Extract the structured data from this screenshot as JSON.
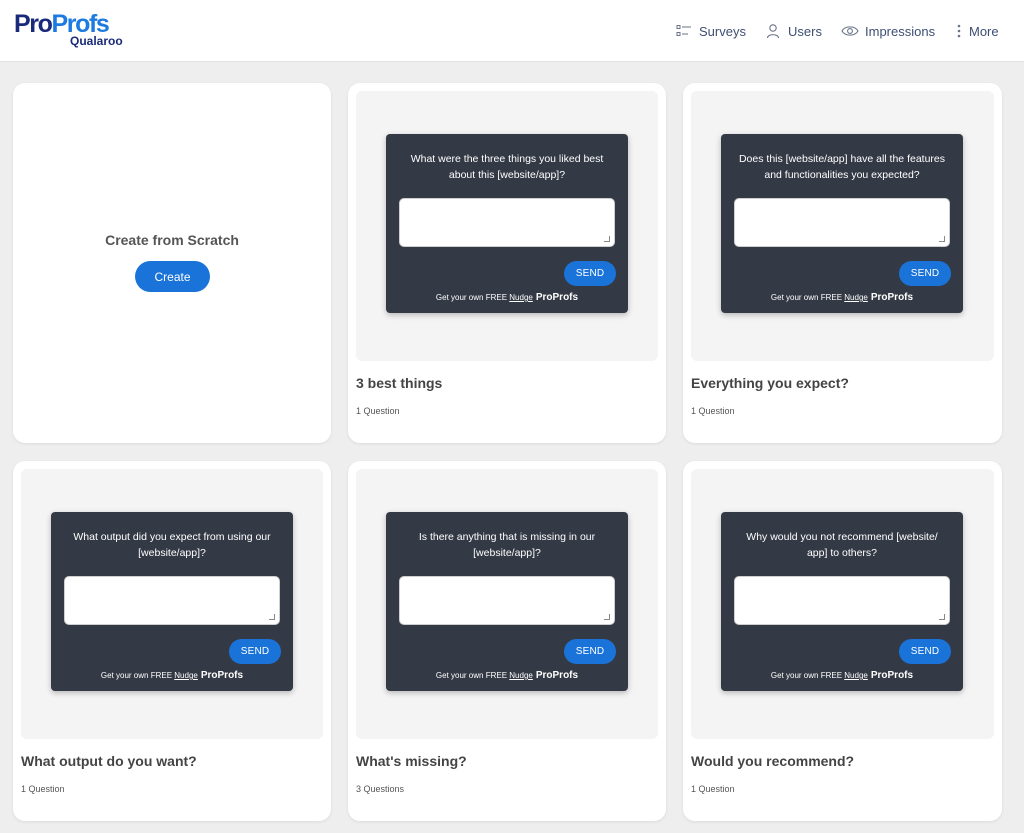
{
  "brand": {
    "logo_pro": "Pro",
    "logo_profs": "Profs",
    "logo_sub": "Qualaroo"
  },
  "nav": [
    {
      "label": "Surveys",
      "icon": "list-icon"
    },
    {
      "label": "Users",
      "icon": "user-icon"
    },
    {
      "label": "Impressions",
      "icon": "eye-icon"
    },
    {
      "label": "More",
      "icon": "more-vertical-icon"
    }
  ],
  "scratch": {
    "title": "Create from Scratch",
    "button_label": "Create"
  },
  "widget": {
    "send_label": "SEND",
    "footer_text": "Get your own FREE ",
    "footer_nudge": "Nudge",
    "footer_brand": "ProProfs"
  },
  "templates": [
    {
      "question": "What were the three things you liked best about this [website/app]?",
      "title": "3 best things",
      "count": "1 Question"
    },
    {
      "question": "Does this [website/app] have all the features and functionalities you expected?",
      "title": "Everything you expect?",
      "count": "1 Question"
    },
    {
      "question": "What output did you expect from using our [website/app]?",
      "title": "What output do you want?",
      "count": "1 Question"
    },
    {
      "question": "Is there anything that is missing in our [website/app]?",
      "title": "What's missing?",
      "count": "3 Questions"
    },
    {
      "question": "Why would you not recommend [website/ app] to others?",
      "title": "Would you recommend?",
      "count": "1 Question"
    }
  ],
  "colors": {
    "accent": "#1a73d9",
    "widget_bg": "#343a45",
    "brand_dark": "#1a2a7a"
  }
}
